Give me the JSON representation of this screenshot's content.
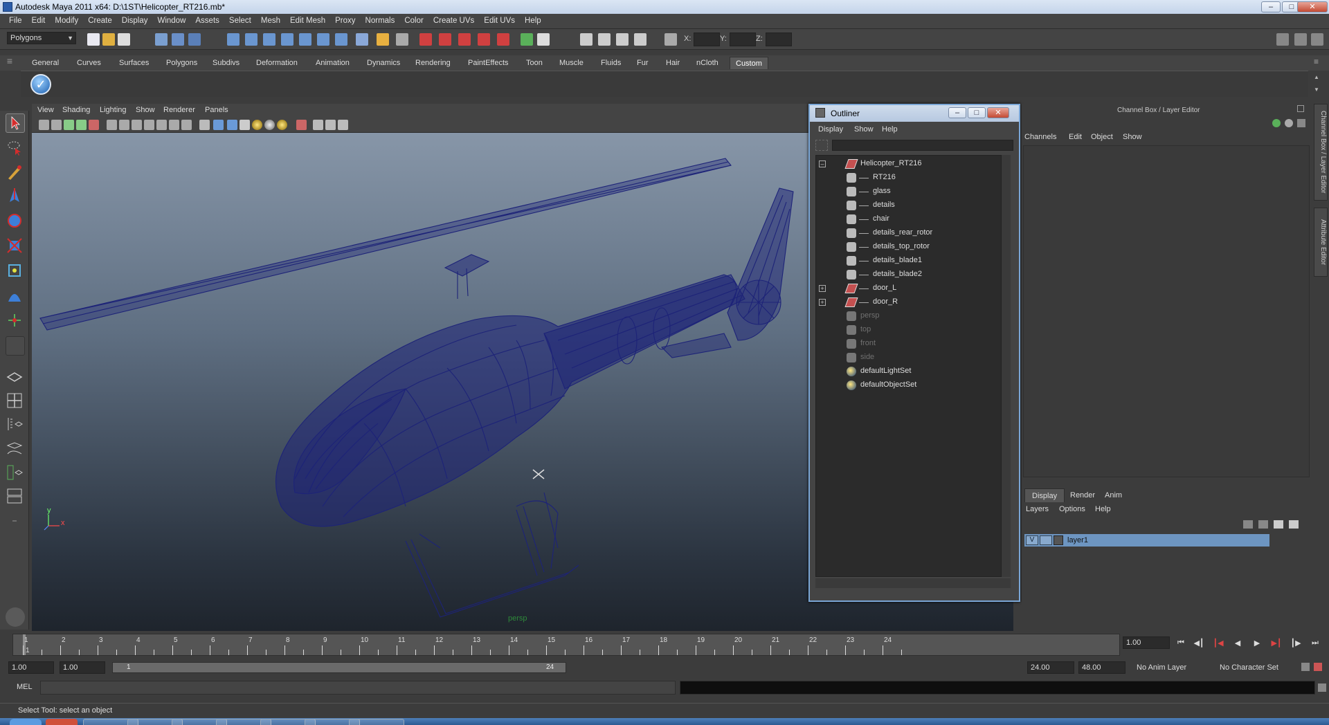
{
  "window": {
    "title": "Autodesk Maya 2011 x64: D:\\1ST\\Helicopter_RT216.mb*"
  },
  "menubar": [
    "File",
    "Edit",
    "Modify",
    "Create",
    "Display",
    "Window",
    "Assets",
    "Select",
    "Mesh",
    "Edit Mesh",
    "Proxy",
    "Normals",
    "Color",
    "Create UVs",
    "Edit UVs",
    "Help"
  ],
  "statusline": {
    "mode": "Polygons",
    "x_label": "X:",
    "y_label": "Y:",
    "z_label": "Z:"
  },
  "shelf": {
    "tabs": [
      "General",
      "Curves",
      "Surfaces",
      "Polygons",
      "Subdivs",
      "Deformation",
      "Animation",
      "Dynamics",
      "Rendering",
      "PaintEffects",
      "Toon",
      "Muscle",
      "Fluids",
      "Fur",
      "Hair",
      "nCloth",
      "Custom"
    ],
    "active_tab": "Custom"
  },
  "viewport": {
    "menu": [
      "View",
      "Shading",
      "Lighting",
      "Show",
      "Renderer",
      "Panels"
    ],
    "camera_label": "persp",
    "axis_y": "y",
    "axis_x": "x",
    "wire_color": "#1d2378"
  },
  "outliner": {
    "title": "Outliner",
    "menu": [
      "Display",
      "Show",
      "Help"
    ],
    "items": [
      {
        "label": "Helicopter_RT216",
        "icon": "transform-icon",
        "dim": false
      },
      {
        "label": "RT216",
        "icon": "mesh-icon",
        "dim": false
      },
      {
        "label": "glass",
        "icon": "mesh-icon",
        "dim": false
      },
      {
        "label": "details",
        "icon": "mesh-icon",
        "dim": false
      },
      {
        "label": "chair",
        "icon": "mesh-icon",
        "dim": false
      },
      {
        "label": "details_rear_rotor",
        "icon": "mesh-icon",
        "dim": false
      },
      {
        "label": "details_top_rotor",
        "icon": "mesh-icon",
        "dim": false
      },
      {
        "label": "details_blade1",
        "icon": "mesh-icon",
        "dim": false
      },
      {
        "label": "details_blade2",
        "icon": "mesh-icon",
        "dim": false
      },
      {
        "label": "door_L",
        "icon": "transform-icon",
        "dim": false
      },
      {
        "label": "door_R",
        "icon": "transform-icon",
        "dim": false
      },
      {
        "label": "persp",
        "icon": "camera-icon",
        "dim": true
      },
      {
        "label": "top",
        "icon": "camera-icon",
        "dim": true
      },
      {
        "label": "front",
        "icon": "camera-icon",
        "dim": true
      },
      {
        "label": "side",
        "icon": "camera-icon",
        "dim": true
      },
      {
        "label": "defaultLightSet",
        "icon": "set-icon",
        "dim": false
      },
      {
        "label": "defaultObjectSet",
        "icon": "set-icon",
        "dim": false
      }
    ]
  },
  "channelbox": {
    "header": "Channel Box / Layer Editor",
    "menu": [
      "Channels",
      "Edit",
      "Object",
      "Show"
    ],
    "tabs": [
      "Display",
      "Render",
      "Anim"
    ],
    "active_tab": "Display",
    "layer_menu": [
      "Layers",
      "Options",
      "Help"
    ],
    "layer": {
      "visible": "V",
      "name": "layer1"
    }
  },
  "sidetabs": [
    "Channel Box / Layer Editor",
    "Attribute Editor"
  ],
  "timeslider": {
    "frames": [
      "1",
      "2",
      "3",
      "4",
      "5",
      "6",
      "7",
      "8",
      "9",
      "10",
      "11",
      "12",
      "13",
      "14",
      "15",
      "16",
      "17",
      "18",
      "19",
      "20",
      "21",
      "22",
      "23",
      "24"
    ],
    "current_frame_label": "1",
    "current_frame": "1.00"
  },
  "rangeslider": {
    "start": "1.00",
    "playback_start": "1.00",
    "range_start_label": "1",
    "range_end_label": "24",
    "playback_end": "24.00",
    "end": "48.00",
    "anim_layer": "No Anim Layer",
    "character_set": "No Character Set"
  },
  "cmdline": {
    "label": "MEL"
  },
  "helpline": {
    "text": "Select Tool: select an object"
  }
}
